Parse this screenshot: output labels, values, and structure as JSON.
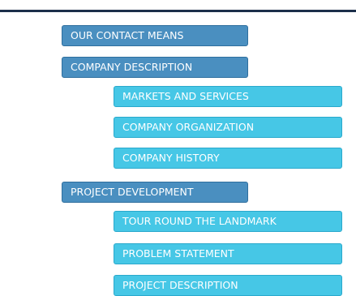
{
  "menu": {
    "contact": "OUR CONTACT MEANS",
    "company_description": "COMPANY DESCRIPTION",
    "markets_services": "MARKETS AND SERVICES",
    "company_organization": "COMPANY ORGANIZATION",
    "company_history": "COMPANY HISTORY",
    "project_development": "PROJECT DEVELOPMENT",
    "tour_landmark": "TOUR ROUND THE LANDMARK",
    "problem_statement": "PROBLEM STATEMENT",
    "project_description": "PROJECT DESCRIPTION"
  },
  "colors": {
    "primary_button": "#4a8fc0",
    "secondary_button": "#46c7e6",
    "top_rule": "#1c2f4a"
  }
}
